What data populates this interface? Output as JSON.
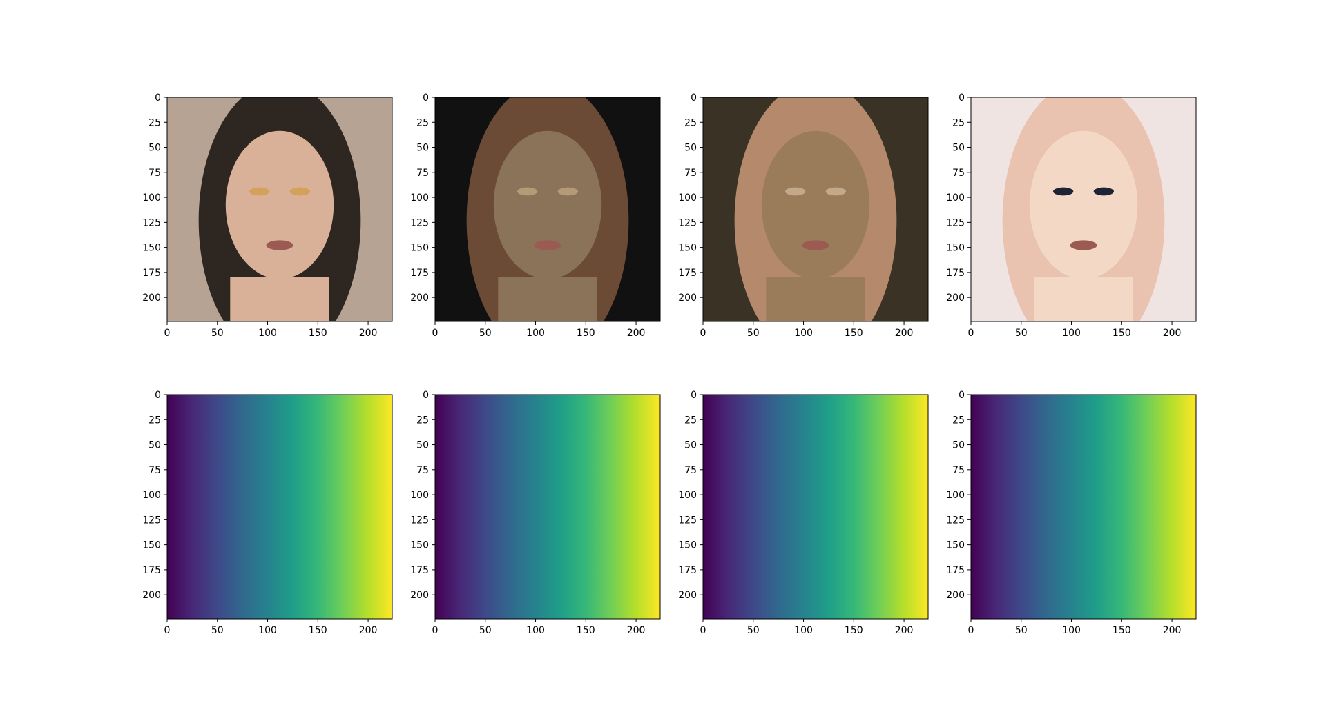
{
  "chart_data": [
    {
      "type": "image",
      "row": 0,
      "col": 0,
      "content": "photo",
      "photo_tones": [
        "#b7a393",
        "#d9b199",
        "#2e2620",
        "#d4a15a"
      ],
      "x_ticks": [
        0,
        50,
        100,
        150,
        200
      ],
      "y_ticks": [
        0,
        25,
        50,
        75,
        100,
        125,
        150,
        175,
        200
      ],
      "xlim": [
        0,
        224
      ],
      "ylim": [
        224,
        0
      ]
    },
    {
      "type": "image",
      "row": 0,
      "col": 1,
      "content": "photo",
      "photo_tones": [
        "#111111",
        "#8a7358",
        "#6b4a36",
        "#b59a78"
      ],
      "x_ticks": [
        0,
        50,
        100,
        150,
        200
      ],
      "y_ticks": [
        0,
        25,
        50,
        75,
        100,
        125,
        150,
        175,
        200
      ],
      "xlim": [
        0,
        224
      ],
      "ylim": [
        224,
        0
      ]
    },
    {
      "type": "image",
      "row": 0,
      "col": 2,
      "content": "photo",
      "photo_tones": [
        "#3b3226",
        "#9a7c5a",
        "#b58a6c",
        "#c3a88a"
      ],
      "x_ticks": [
        0,
        50,
        100,
        150,
        200
      ],
      "y_ticks": [
        0,
        25,
        50,
        75,
        100,
        125,
        150,
        175,
        200
      ],
      "xlim": [
        0,
        224
      ],
      "ylim": [
        224,
        0
      ]
    },
    {
      "type": "image",
      "row": 0,
      "col": 3,
      "content": "photo",
      "photo_tones": [
        "#f0e4e2",
        "#f3d8c6",
        "#e9c3b0",
        "#1e2433"
      ],
      "x_ticks": [
        0,
        50,
        100,
        150,
        200
      ],
      "y_ticks": [
        0,
        25,
        50,
        75,
        100,
        125,
        150,
        175,
        200
      ],
      "xlim": [
        0,
        224
      ],
      "ylim": [
        224,
        0
      ]
    },
    {
      "type": "heatmap",
      "row": 1,
      "col": 0,
      "colormap": "viridis",
      "gradient": "horizontal",
      "value_range": [
        0,
        224
      ],
      "x_ticks": [
        0,
        50,
        100,
        150,
        200
      ],
      "y_ticks": [
        0,
        25,
        50,
        75,
        100,
        125,
        150,
        175,
        200
      ],
      "xlim": [
        0,
        224
      ],
      "ylim": [
        224,
        0
      ]
    },
    {
      "type": "heatmap",
      "row": 1,
      "col": 1,
      "colormap": "viridis",
      "gradient": "horizontal",
      "value_range": [
        0,
        224
      ],
      "x_ticks": [
        0,
        50,
        100,
        150,
        200
      ],
      "y_ticks": [
        0,
        25,
        50,
        75,
        100,
        125,
        150,
        175,
        200
      ],
      "xlim": [
        0,
        224
      ],
      "ylim": [
        224,
        0
      ]
    },
    {
      "type": "heatmap",
      "row": 1,
      "col": 2,
      "colormap": "viridis",
      "gradient": "horizontal",
      "value_range": [
        0,
        224
      ],
      "x_ticks": [
        0,
        50,
        100,
        150,
        200
      ],
      "y_ticks": [
        0,
        25,
        50,
        75,
        100,
        125,
        150,
        175,
        200
      ],
      "xlim": [
        0,
        224
      ],
      "ylim": [
        224,
        0
      ]
    },
    {
      "type": "heatmap",
      "row": 1,
      "col": 3,
      "colormap": "viridis",
      "gradient": "horizontal",
      "value_range": [
        0,
        224
      ],
      "x_ticks": [
        0,
        50,
        100,
        150,
        200
      ],
      "y_ticks": [
        0,
        25,
        50,
        75,
        100,
        125,
        150,
        175,
        200
      ],
      "xlim": [
        0,
        224
      ],
      "ylim": [
        224,
        0
      ]
    }
  ],
  "colors": {
    "viridis": [
      "#440154",
      "#482878",
      "#3e4989",
      "#31688e",
      "#26828e",
      "#1f9e89",
      "#35b779",
      "#6ece58",
      "#b5de2b",
      "#fde725"
    ]
  }
}
